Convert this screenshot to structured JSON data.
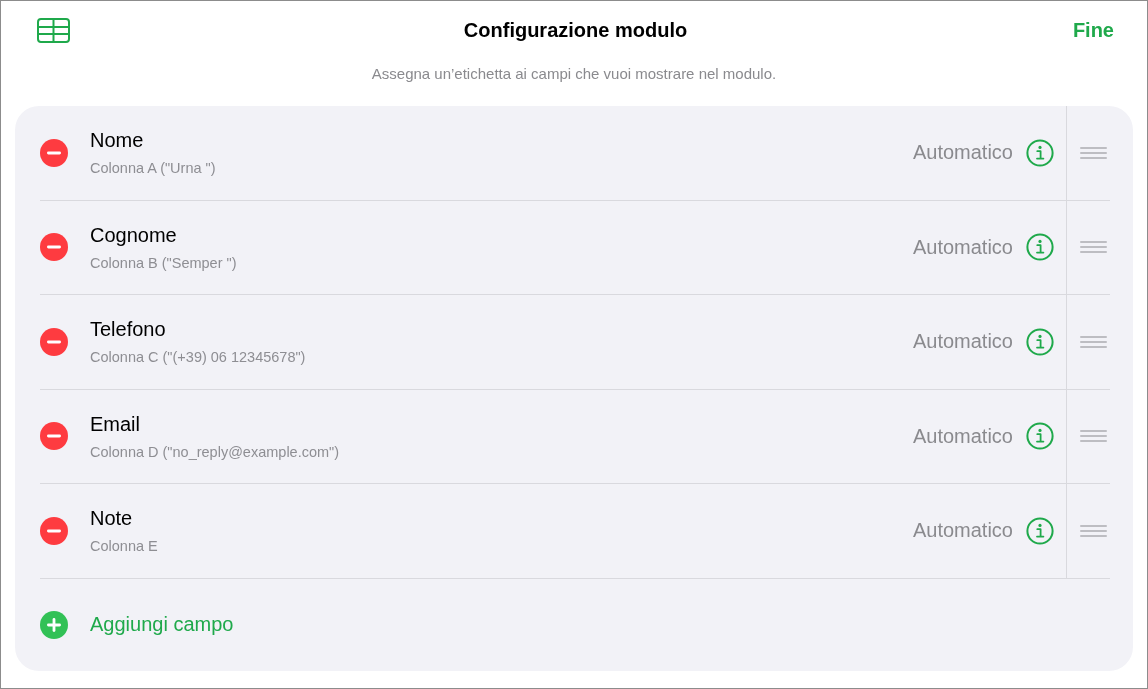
{
  "toolbar": {
    "title": "Configurazione modulo",
    "done_button": "Fine"
  },
  "subtitle": "Assegna un’etichetta ai campi che vuoi mostrare nel modulo.",
  "fields": [
    {
      "name": "Nome",
      "column": "Colonna A (\"Urna \")",
      "type": "Automatico"
    },
    {
      "name": "Cognome",
      "column": "Colonna B (\"Semper \")",
      "type": "Automatico"
    },
    {
      "name": "Telefono",
      "column": "Colonna C (\"(+39) 06 12345678\")",
      "type": "Automatico"
    },
    {
      "name": "Email",
      "column": "Colonna D (\"no_reply@example.com\")",
      "type": "Automatico"
    },
    {
      "name": "Note",
      "column": "Colonna E",
      "type": "Automatico"
    }
  ],
  "add_button": {
    "label": "Aggiungi campo"
  }
}
